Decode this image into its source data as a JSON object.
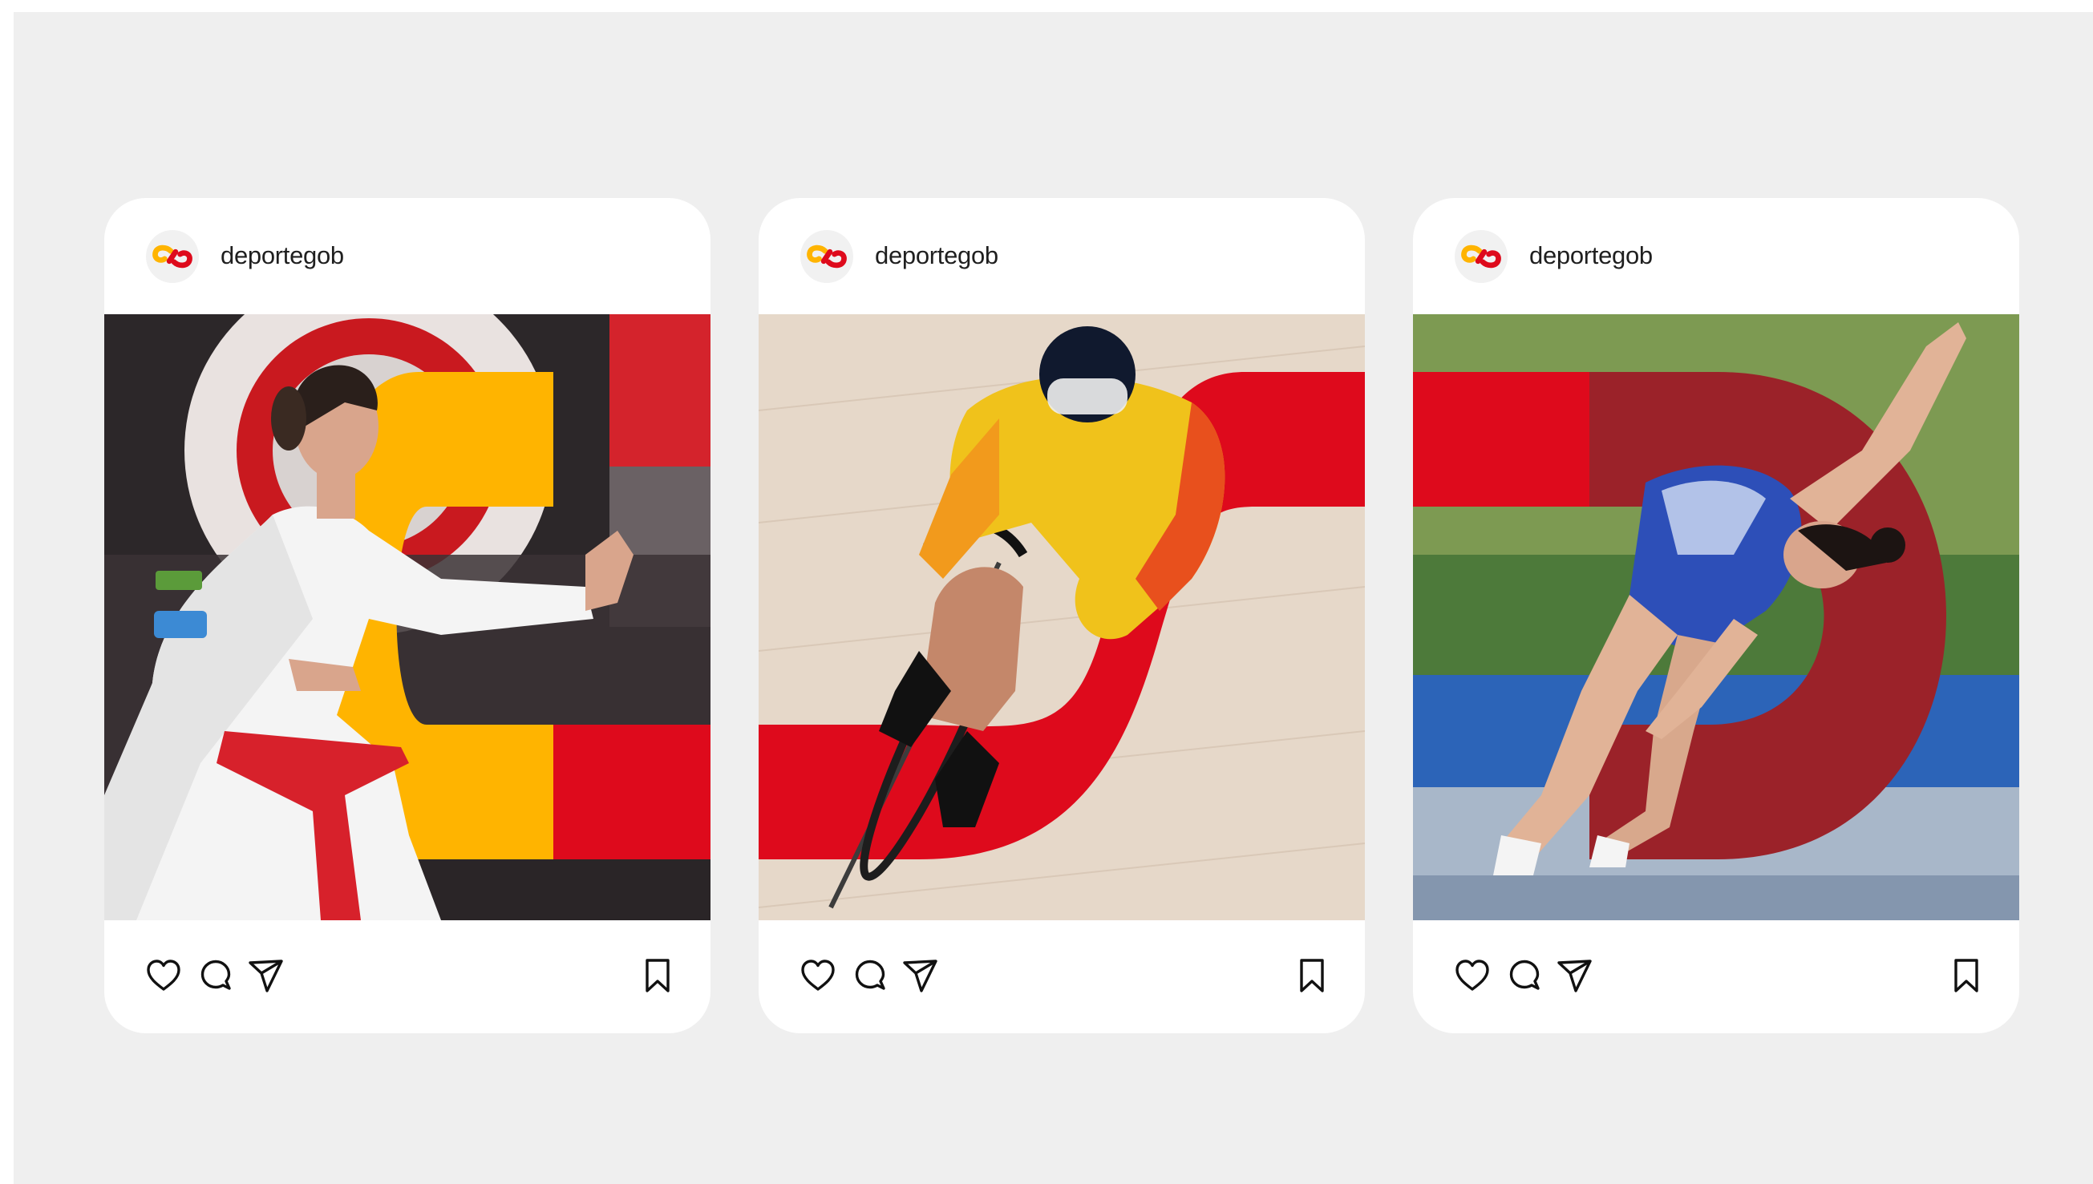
{
  "colors": {
    "page_background": "#ffffff",
    "canvas_background": "#efefef",
    "brand_yellow": "#ffb400",
    "brand_red": "#de0a1c",
    "brand_dark_red": "#9b2229"
  },
  "posts": [
    {
      "username": "deportegob",
      "image_icon": "karate-athlete-photo",
      "actions": [
        "heart-icon",
        "comment-icon",
        "share-icon",
        "bookmark-icon"
      ]
    },
    {
      "username": "deportegob",
      "image_icon": "track-cyclist-photo",
      "actions": [
        "heart-icon",
        "comment-icon",
        "share-icon",
        "bookmark-icon"
      ]
    },
    {
      "username": "deportegob",
      "image_icon": "trampoline-gymnast-photo",
      "actions": [
        "heart-icon",
        "comment-icon",
        "share-icon",
        "bookmark-icon"
      ]
    }
  ]
}
